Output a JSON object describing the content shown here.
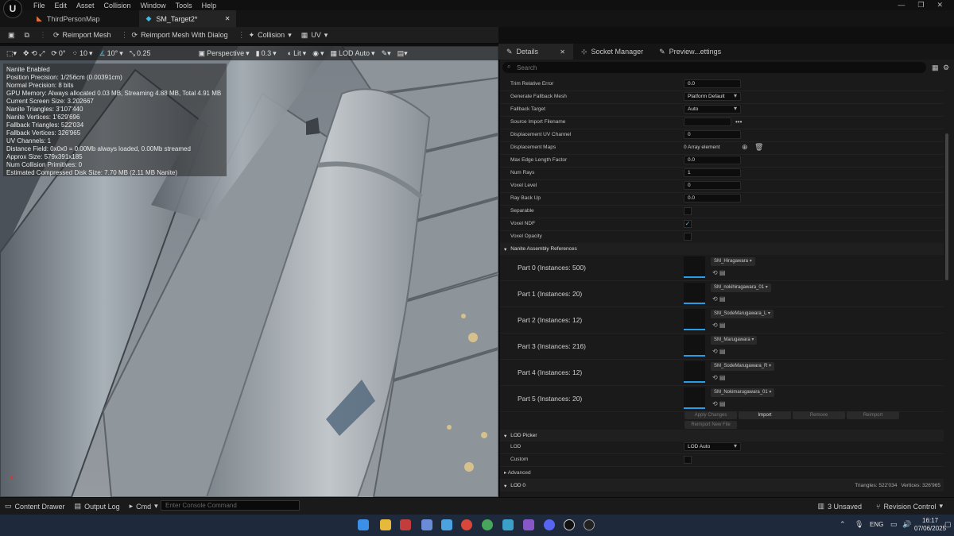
{
  "menu": [
    "File",
    "Edit",
    "Asset",
    "Collision",
    "Window",
    "Tools",
    "Help"
  ],
  "tabs": [
    {
      "label": "ThirdPersonMap"
    },
    {
      "label": "SM_Target2*"
    }
  ],
  "toolbar": {
    "reimport": "Reimport Mesh",
    "reimport_dialog": "Reimport Mesh With Dialog",
    "collision": "Collision",
    "uv": "UV"
  },
  "viewport_bar": {
    "rot": "0°",
    "snap": "10",
    "angle": "10°",
    "scale": "0.25",
    "perspective": "Perspective",
    "speed": "0.3",
    "lit": "Lit",
    "lod": "LOD Auto"
  },
  "stats": [
    "Nanite Enabled",
    "Position Precision: 1/256cm (0.00391cm)",
    "Normal Precision: 8 bits",
    "GPU Memory: Always allocated 0.03 MB, Streaming 4.88 MB, Total 4.91 MB",
    "Current Screen Size: 3.202667",
    "Nanite Triangles: 3'107'440",
    "Nanite Vertices: 1'629'696",
    "Fallback Triangles: 522'034",
    "Fallback Vertices: 326'965",
    "UV Channels: 1",
    "Distance Field: 0x0x0 = 0.00Mb always loaded, 0.00Mb streamed",
    "Approx Size: 579x391x185",
    "Num Collision Primitives: 0",
    "Estimated Compressed Disk Size: 7.70 MB (2.11 MB Nanite)"
  ],
  "right_tabs": [
    "Details",
    "Socket Manager",
    "Preview...ettings"
  ],
  "search_placeholder": "Search",
  "props": [
    {
      "label": "Trim Relative Error",
      "value": "0.0"
    },
    {
      "label": "Generate Fallback Mesh",
      "value": "Platform Default"
    },
    {
      "label": "Fallback Target",
      "value": "Auto"
    },
    {
      "label": "Source Import Filename",
      "value": ""
    },
    {
      "label": "Displacement UV Channel",
      "value": "0"
    },
    {
      "label": "Displacement Maps",
      "value": "0 Array element"
    },
    {
      "label": "Max Edge Length Factor",
      "value": "0.0"
    },
    {
      "label": "Num Rays",
      "value": "1"
    },
    {
      "label": "Voxel Level",
      "value": "0"
    },
    {
      "label": "Ray Back Up",
      "value": "0.0"
    },
    {
      "label": "Separable",
      "value": ""
    },
    {
      "label": "Voxel NDF",
      "value": ""
    },
    {
      "label": "Voxel Opacity",
      "value": ""
    }
  ],
  "assembly_section": "Nanite Assembly References",
  "parts": [
    {
      "label": "Part 0 (Instances: 500)",
      "mesh": "SM_Hiragawara"
    },
    {
      "label": "Part 1 (Instances: 20)",
      "mesh": "SM_nokihiragawara_01"
    },
    {
      "label": "Part 2 (Instances: 12)",
      "mesh": "SM_SodeMarugawara_L"
    },
    {
      "label": "Part 3 (Instances: 216)",
      "mesh": "SM_Marugawara"
    },
    {
      "label": "Part 4 (Instances: 12)",
      "mesh": "SM_SodeMarugawara_R"
    },
    {
      "label": "Part 5 (Instances: 20)",
      "mesh": "SM_Nokimarugawara_01"
    }
  ],
  "part_buttons": [
    "Apply Changes",
    "Import",
    "Remove",
    "Reimport"
  ],
  "reimport_new": "Reimport New File",
  "lod_picker": {
    "section": "LOD Picker",
    "lod_label": "LOD",
    "lod_value": "LOD Auto",
    "custom_label": "Custom",
    "advanced": "Advanced"
  },
  "lod0": {
    "label": "LOD 0",
    "triangles": "Triangles: 522'034",
    "vertices": "Vertices: 326'965"
  },
  "status": {
    "content_drawer": "Content Drawer",
    "output_log": "Output Log",
    "cmd": "Cmd",
    "console_placeholder": "Enter Console Command",
    "unsaved": "3 Unsaved",
    "revision": "Revision Control"
  },
  "taskbar": {
    "lang": "ENG",
    "time": "16:17",
    "date": "07/06/2025"
  },
  "colors": {
    "accent": "#2b9be6",
    "panel": "#1a1a1a",
    "viewport_sky": "#6d7379"
  }
}
